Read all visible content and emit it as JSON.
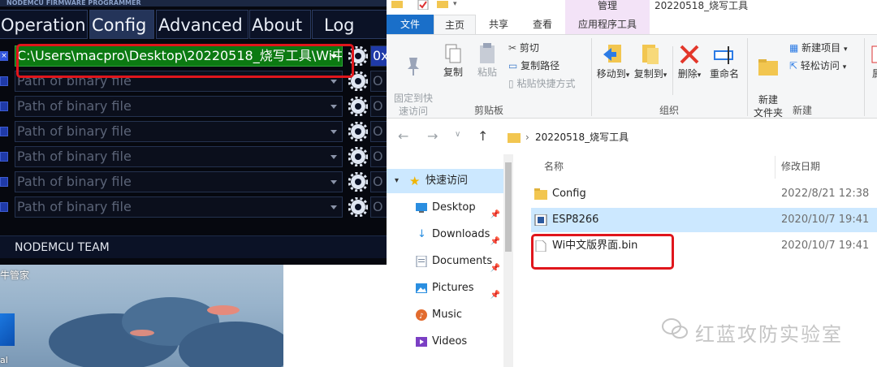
{
  "nodemcu": {
    "window_title": "NODEMCU FIRMWARE PROGRAMMER",
    "tabs": [
      "Operation",
      "Config",
      "Advanced",
      "About",
      "Log"
    ],
    "active_tab": "Config",
    "rows": [
      {
        "path": "C:\\Users\\macpro\\Desktop\\20220518_烧写工具\\Wi中",
        "offset": "0x",
        "checked": true
      },
      {
        "path": "Path of binary file",
        "offset": "O",
        "checked": false
      },
      {
        "path": "Path of binary file",
        "offset": "O",
        "checked": false
      },
      {
        "path": "Path of binary file",
        "offset": "O",
        "checked": false
      },
      {
        "path": "Path of binary file",
        "offset": "O",
        "checked": false
      },
      {
        "path": "Path of binary file",
        "offset": "O",
        "checked": false
      },
      {
        "path": "Path of binary file",
        "offset": "O",
        "checked": false
      }
    ],
    "footer": "NODEMCU TEAM",
    "highlight_color": "#e0161c"
  },
  "wallpaper": {
    "caption": "牛管家",
    "bottom_text": "al"
  },
  "explorer": {
    "window_title": "20220518_烧写工具",
    "context_tab_group": "管理",
    "tabs": [
      "文件",
      "主页",
      "共享",
      "查看",
      "应用程序工具"
    ],
    "ribbon": {
      "pin_quick_access": "固定到快\n速访问",
      "copy": "复制",
      "paste": "粘贴",
      "cut": "剪切",
      "copy_path": "复制路径",
      "paste_shortcut": "粘贴快捷方式",
      "clipboard_group": "剪贴板",
      "move_to": "移动到",
      "copy_to": "复制到",
      "delete": "删除",
      "rename": "重命名",
      "organize_group": "组织",
      "new_folder": "新建\n文件夹",
      "new_item": "新建项目",
      "easy_access": "轻松访问",
      "new_group": "新建",
      "more_partial": "属"
    },
    "address": {
      "folder": "20220518_烧写工具"
    },
    "nav_pane": [
      {
        "label": "快速访问",
        "icon": "star-icon"
      },
      {
        "label": "Desktop",
        "icon": "desktop-icon",
        "pinned": true
      },
      {
        "label": "Downloads",
        "icon": "download-icon",
        "pinned": true
      },
      {
        "label": "Documents",
        "icon": "documents-icon",
        "pinned": true
      },
      {
        "label": "Pictures",
        "icon": "pictures-icon",
        "pinned": true
      },
      {
        "label": "Music",
        "icon": "music-icon"
      },
      {
        "label": "Videos",
        "icon": "videos-icon"
      }
    ],
    "columns": {
      "name": "名称",
      "modified": "修改日期"
    },
    "files": [
      {
        "name": "Config",
        "date": "2022/8/21 12:38",
        "icon": "folder-icon"
      },
      {
        "name": "ESP8266",
        "date": "2020/10/7 19:41",
        "icon": "exe-icon",
        "selected": true
      },
      {
        "name": "Wi中文版界面.bin",
        "date": "2020/10/7 19:41",
        "icon": "file-icon"
      }
    ],
    "watermark": "红蓝攻防实验室",
    "accent": "#1a6fc9",
    "selection": "#cce8ff"
  }
}
